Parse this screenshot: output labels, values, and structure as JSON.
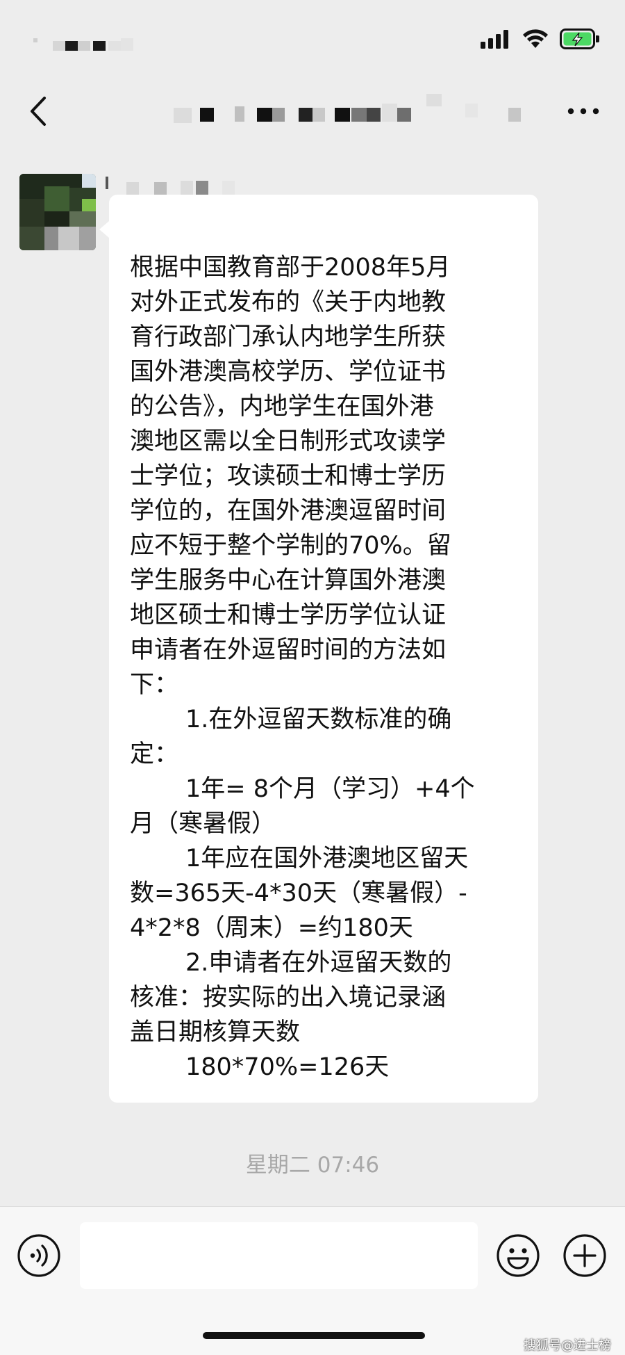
{
  "status_bar": {
    "icons": [
      "cellular-signal-icon",
      "wifi-icon",
      "battery-charging-icon"
    ],
    "battery_color": "#4cd964"
  },
  "nav": {
    "back_icon": "chevron-left-icon",
    "more_icon": "more-horizontal-icon"
  },
  "message": {
    "lines": [
      "根据中国教育部于2008年5月",
      "对外正式发布的《关于内地教",
      "育行政部门承认内地学生所获",
      "国外港澳高校学历、学位证书",
      "的公告》，内地学生在国外港",
      "澳地区需以全日制形式攻读学",
      "士学位；攻读硕士和博士学历",
      "学位的，在国外港澳逗留时间",
      "应不短于整个学制的70%。留",
      "学生服务中心在计算国外港澳",
      "地区硕士和博士学历学位认证",
      "申请者在外逗留时间的方法如",
      "下：",
      "1.在外逗留天数标准的确",
      "定：",
      "1年= 8个月（学习）+4个",
      "月（寒暑假）",
      "1年应在国外港澳地区留天",
      "数=365天-4*30天（寒暑假）-",
      "4*2*8（周末）=约180天",
      "2.申请者在外逗留天数的",
      "核准：按实际的出入境记录涵",
      "盖日期核算天数",
      "180*70%=126天"
    ]
  },
  "timestamp": "星期二 07:46",
  "input_bar": {
    "voice_icon": "voice-icon",
    "emoji_icon": "emoji-icon",
    "plus_icon": "plus-icon",
    "input_value": ""
  },
  "watermark": "搜狐号@进士榜",
  "colors": {
    "background": "#ededed",
    "bubble": "#ffffff",
    "timestamp": "#a8a8a8",
    "input_bar": "#f7f7f7"
  }
}
